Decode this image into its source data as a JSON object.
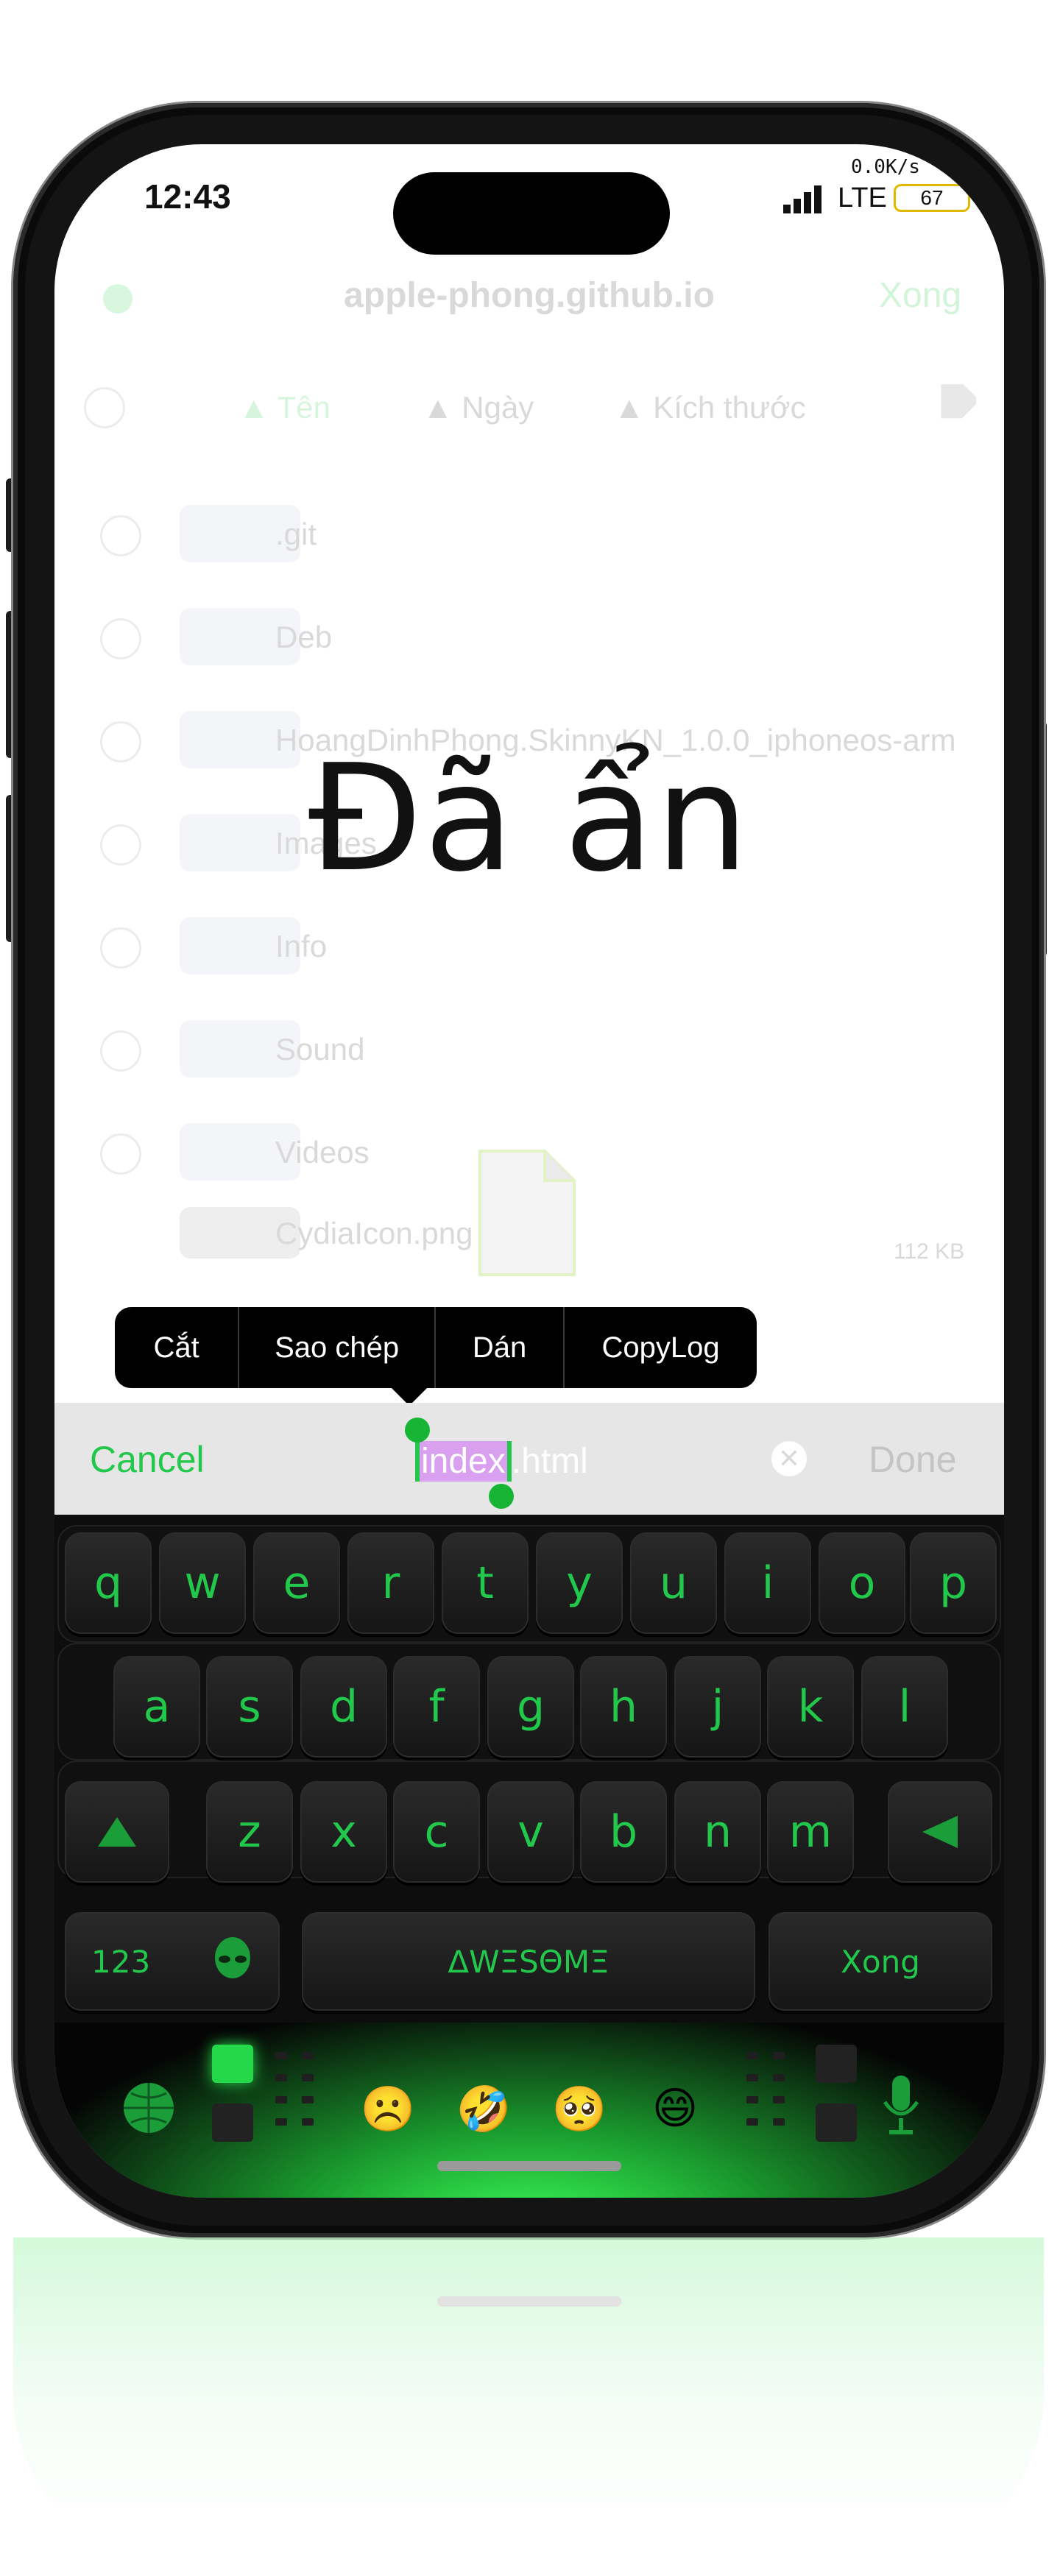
{
  "status": {
    "time": "12:43",
    "speed": "0.0K/s",
    "network": "LTE",
    "battery": "67"
  },
  "browser": {
    "title": "apple-phong.github.io",
    "done": "Xong",
    "sort": {
      "name": "Tên",
      "date": "Ngày",
      "size": "Kích thước"
    },
    "files": [
      {
        "name": ".git"
      },
      {
        "name": "Deb"
      },
      {
        "name": "HoangDinhPhong.SkinnyKN_1.0.0_iphoneos-arm"
      },
      {
        "name": "Images"
      },
      {
        "name": "Info"
      },
      {
        "name": "Sound"
      },
      {
        "name": "Videos"
      },
      {
        "name": "CydiaIcon.png",
        "size": "112 KB"
      }
    ]
  },
  "overlay": {
    "text": "Đã ẩn"
  },
  "context_menu": {
    "items": [
      "Cắt",
      "Sao chép",
      "Dán",
      "CopyLog"
    ]
  },
  "rename": {
    "cancel": "Cancel",
    "selected": "index",
    "rest": ".html",
    "done": "Done"
  },
  "keyboard": {
    "row1": [
      "q",
      "w",
      "e",
      "r",
      "t",
      "y",
      "u",
      "i",
      "o",
      "p"
    ],
    "row2": [
      "a",
      "s",
      "d",
      "f",
      "g",
      "h",
      "j",
      "k",
      "l"
    ],
    "row3": [
      "z",
      "x",
      "c",
      "v",
      "b",
      "n",
      "m"
    ],
    "numbers": "123",
    "space": "ΔWΞSΘMΞ",
    "return": "Xong",
    "emojis": [
      "☹️",
      "🤣",
      "🥺",
      "😄"
    ],
    "accent": "#22c84b"
  }
}
